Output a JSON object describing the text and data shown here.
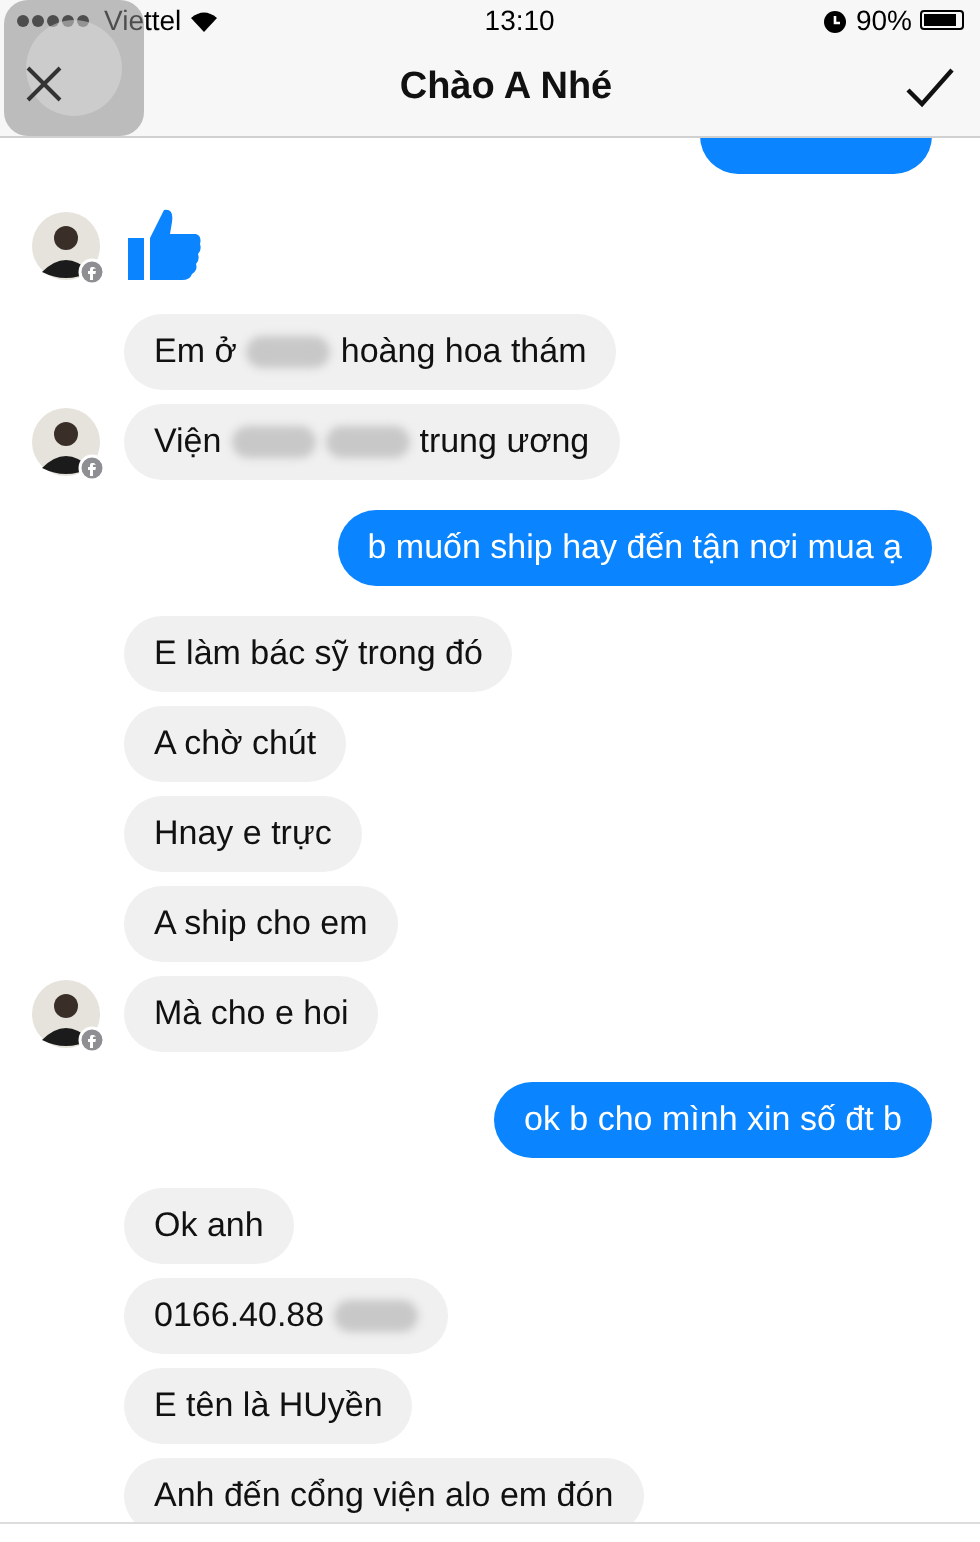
{
  "status_bar": {
    "carrier": "Viettel",
    "time": "13:10",
    "battery": "90%"
  },
  "header": {
    "title": "Chào A Nhé"
  },
  "groups": [
    {
      "kind": "sent",
      "items": [
        {
          "kind": "clipped"
        }
      ]
    },
    {
      "kind": "received",
      "items": [
        {
          "kind": "like",
          "avatar": true
        }
      ]
    },
    {
      "kind": "received",
      "items": [
        {
          "kind": "text",
          "avatar": false,
          "segments": [
            {
              "kind": "text",
              "text": "Em ở"
            },
            {
              "kind": "redacted"
            },
            {
              "kind": "text",
              "text": "hoàng hoa thám"
            }
          ]
        },
        {
          "kind": "text",
          "avatar": true,
          "segments": [
            {
              "kind": "text",
              "text": "Viện"
            },
            {
              "kind": "redacted"
            },
            {
              "kind": "redacted"
            },
            {
              "kind": "text",
              "text": "trung ương"
            }
          ]
        }
      ]
    },
    {
      "kind": "sent",
      "items": [
        {
          "kind": "text",
          "segments": [
            {
              "kind": "text",
              "text": "b muốn ship hay đến tận nơi mua ạ"
            }
          ]
        }
      ]
    },
    {
      "kind": "received",
      "items": [
        {
          "kind": "text",
          "avatar": false,
          "segments": [
            {
              "kind": "text",
              "text": "E làm bác sỹ trong đó"
            }
          ]
        },
        {
          "kind": "text",
          "avatar": false,
          "segments": [
            {
              "kind": "text",
              "text": "A chờ chút"
            }
          ]
        },
        {
          "kind": "text",
          "avatar": false,
          "segments": [
            {
              "kind": "text",
              "text": "Hnay e trực"
            }
          ]
        },
        {
          "kind": "text",
          "avatar": false,
          "segments": [
            {
              "kind": "text",
              "text": "A ship cho em"
            }
          ]
        },
        {
          "kind": "text",
          "avatar": true,
          "segments": [
            {
              "kind": "text",
              "text": "Mà cho e hoi"
            }
          ]
        }
      ]
    },
    {
      "kind": "sent",
      "items": [
        {
          "kind": "text",
          "segments": [
            {
              "kind": "text",
              "text": "ok b cho mình xin số đt b"
            }
          ]
        }
      ]
    },
    {
      "kind": "received",
      "items": [
        {
          "kind": "text",
          "avatar": false,
          "segments": [
            {
              "kind": "text",
              "text": "Ok anh"
            }
          ]
        },
        {
          "kind": "text",
          "avatar": false,
          "segments": [
            {
              "kind": "text",
              "text": "0166.40.88"
            },
            {
              "kind": "redacted"
            }
          ]
        },
        {
          "kind": "text",
          "avatar": false,
          "segments": [
            {
              "kind": "text",
              "text": "E tên là HUyền"
            }
          ]
        },
        {
          "kind": "text",
          "avatar": false,
          "segments": [
            {
              "kind": "text",
              "text": "Anh đến cổng viện alo em đón"
            }
          ]
        }
      ]
    }
  ]
}
